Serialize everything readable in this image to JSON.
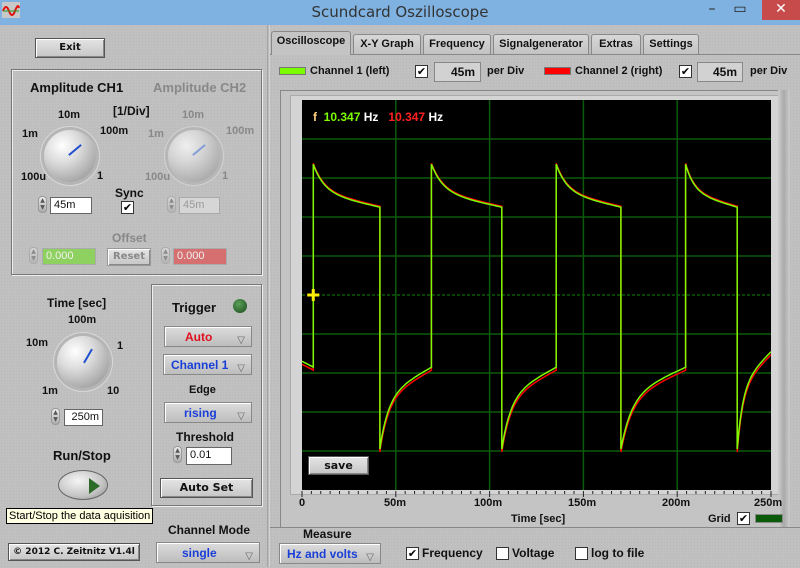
{
  "window": {
    "title": "Scundcard Oszilloscope",
    "minimize_icon": "minimize-icon",
    "maximize_icon": "maximize-icon",
    "close_icon": "close-icon",
    "close_glyph": "✕",
    "minimize_glyph": "–",
    "maximize_glyph": "▭"
  },
  "left": {
    "exit_label": "Exit",
    "amplitude": {
      "ch1_title": "Amplitude CH1",
      "ch2_title": "Amplitude CH2",
      "unit_label": "[1/Div]",
      "scale_labels": [
        "100u",
        "1m",
        "10m",
        "100m",
        "1"
      ],
      "ch1_value": "45m",
      "ch2_value": "45m",
      "sync_label": "Sync",
      "sync_checked": true,
      "offset_label": "Offset",
      "offset_ch1": "0.000",
      "offset_ch2": "0.000",
      "reset_label": "Reset"
    },
    "time": {
      "title": "Time [sec]",
      "scale_labels": [
        "1m",
        "10m",
        "100m",
        "1",
        "10"
      ],
      "value": "250m"
    },
    "runstop": {
      "title": "Run/Stop",
      "tooltip": "Start/Stop the data aquisition"
    },
    "trigger": {
      "title": "Trigger",
      "mode": "Auto",
      "channel": "Channel 1",
      "edge_label": "Edge",
      "edge": "rising",
      "threshold_label": "Threshold",
      "threshold": "0.01",
      "autoset_label": "Auto Set"
    },
    "channel_mode": {
      "label": "Channel Mode",
      "value": "single"
    },
    "copyright": "© 2012  C. Zeitnitz V1.4l"
  },
  "tabs": [
    {
      "label": "Oscilloscope",
      "active": true
    },
    {
      "label": "X-Y Graph",
      "active": false
    },
    {
      "label": "Frequency",
      "active": false
    },
    {
      "label": "Signalgenerator",
      "active": false
    },
    {
      "label": "Extras",
      "active": false
    },
    {
      "label": "Settings",
      "active": false
    }
  ],
  "channels": {
    "ch1": {
      "label": "Channel 1 (left)",
      "enabled": true,
      "per_div": "45m",
      "color": "#7cfc00"
    },
    "ch2": {
      "label": "Channel 2 (right)",
      "enabled": true,
      "per_div": "45m",
      "color": "#ff0000"
    },
    "per_div_label": "per Div"
  },
  "scope": {
    "freq_prefix": "f",
    "freq_ch1": "10.347",
    "freq_ch2": "10.347",
    "freq_unit": "Hz",
    "save_label": "save",
    "x_axis_label": "Time [sec]",
    "grid_label": "Grid",
    "grid_checked": true,
    "grid_color": "#0a5a0a"
  },
  "measure": {
    "label": "Measure",
    "mode": "Hz and volts",
    "options": [
      {
        "label": "Frequency",
        "checked": true
      },
      {
        "label": "Voltage",
        "checked": false
      },
      {
        "label": "log to file",
        "checked": false
      }
    ]
  },
  "chart_data": {
    "type": "line",
    "title": "",
    "xlabel": "Time [sec]",
    "ylabel": "",
    "x_tick_labels": [
      "0",
      "50m",
      "100m",
      "150m",
      "200m",
      "250m"
    ],
    "xlim": [
      0,
      0.25
    ],
    "y_divisions": 10,
    "x_divisions": 5,
    "grid": true,
    "trigger_level_div": 0,
    "series": [
      {
        "name": "Channel 1 (left)",
        "color": "#7cfc00",
        "frequency_hz": 10.347,
        "waveform": "square (AC coupled)",
        "rising_edges_s": [
          0.006,
          0.069,
          0.1355,
          0.2045
        ],
        "falling_edges_s": [
          0.0415,
          0.1065,
          0.17,
          0.232
        ],
        "high_start_div": 3.35,
        "high_end_div": 2.25,
        "low_start_div": -3.95,
        "low_end_div": -1.85
      },
      {
        "name": "Channel 2 (right)",
        "color": "#ff0000",
        "frequency_hz": 10.347,
        "waveform": "square (AC coupled)",
        "rising_edges_s": [
          0.006,
          0.069,
          0.1355,
          0.2045
        ],
        "falling_edges_s": [
          0.0415,
          0.1065,
          0.17,
          0.232
        ],
        "high_start_div": 3.4,
        "high_end_div": 2.3,
        "low_start_div": -4.0,
        "low_end_div": -1.9
      }
    ]
  }
}
